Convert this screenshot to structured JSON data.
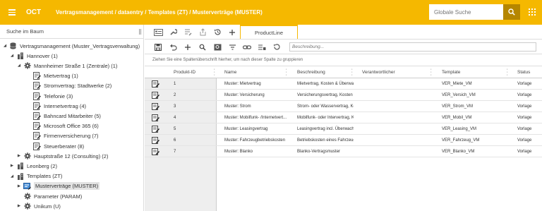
{
  "header": {
    "app_name": "OCT",
    "breadcrumb": "Vertragsmanagement / dataentry / Templates (ZT) / Musterverträge (MUSTER)",
    "search_placeholder": "Globale Suche"
  },
  "tree": {
    "search_label": "Suche im Baum",
    "nodes": [
      {
        "label": "Vertragsmanagement (Muster_Vertragsverwaltung)",
        "icon": "database-icon",
        "arrow": "open"
      },
      {
        "label": "Hannover (1)",
        "icon": "building-icon",
        "arrow": "open"
      },
      {
        "label": "Mannheimer Straße 1 (Zentrale) (1)",
        "icon": "gear-icon",
        "arrow": "open"
      },
      {
        "label": "Mietvertrag (1)",
        "icon": "contract-icon",
        "arrow": ""
      },
      {
        "label": "Stromvertrag: Stadtwerke (2)",
        "icon": "contract-icon",
        "arrow": ""
      },
      {
        "label": "Telefonie (3)",
        "icon": "contract-icon",
        "arrow": ""
      },
      {
        "label": "Internetvertrag (4)",
        "icon": "contract-icon",
        "arrow": ""
      },
      {
        "label": "Bahncard Mitarbeiter (5)",
        "icon": "contract-icon",
        "arrow": ""
      },
      {
        "label": "Microsoft Office 365 (6)",
        "icon": "contract-icon",
        "arrow": ""
      },
      {
        "label": "Firmenversicherung (7)",
        "icon": "contract-icon",
        "arrow": ""
      },
      {
        "label": "Steuerberater (8)",
        "icon": "contract-icon",
        "arrow": ""
      },
      {
        "label": "Hauptstraße 12 (Consulting) (2)",
        "icon": "gear-icon",
        "arrow": "closed"
      },
      {
        "label": "Leonberg (2)",
        "icon": "building-icon",
        "arrow": "closed"
      },
      {
        "label": "Templates (ZT)",
        "icon": "building-icon",
        "arrow": "open"
      },
      {
        "label": "Musterverträge (MUSTER)",
        "icon": "template-icon",
        "arrow": "closed",
        "selected": true
      },
      {
        "label": "Parameter (PARAM)",
        "icon": "gear-icon",
        "arrow": ""
      },
      {
        "label": "Unikum (U)",
        "icon": "gear-icon",
        "arrow": "closed"
      }
    ]
  },
  "tabs": {
    "active": "ProductLine"
  },
  "toolbar": {
    "description_placeholder": "Beschreibung..."
  },
  "group_hint": "Ziehen Sie eine Spaltenüberschrift hierher, um nach dieser Spalte zu gruppieren",
  "table": {
    "columns": [
      "Produkt-ID",
      "Name",
      "Beschreibung",
      "Verantwortlicher",
      "Template",
      "Status"
    ],
    "rows": [
      {
        "id": "1",
        "name": "Muster: Mietvertrag",
        "desc": "Mietvertrag, Kosten & Überwach...",
        "owner": "",
        "template": "VER_Miete_VM",
        "status": "Vorlage"
      },
      {
        "id": "2",
        "name": "Muster: Versicherung",
        "desc": "Versicherungsvertrag, Kosten & ...",
        "owner": "",
        "template": "VER_Versich_VM",
        "status": "Vorlage"
      },
      {
        "id": "3",
        "name": "Muster: Strom",
        "desc": "Strom- oder Wasservertrag, Ko...",
        "owner": "",
        "template": "VER_Strom_VM",
        "status": "Vorlage"
      },
      {
        "id": "4",
        "name": "Muster: Mobilfunk- /Internetvert...",
        "desc": "Mobilfunk- oder Intervertrag, K...",
        "owner": "",
        "template": "VER_Mobil_VM",
        "status": "Vorlage"
      },
      {
        "id": "5",
        "name": "Muster: Leasingvertrag",
        "desc": "Leasingvertrag incl. Überwachu...",
        "owner": "",
        "template": "VER_Leasing_VM",
        "status": "Vorlage"
      },
      {
        "id": "6",
        "name": "Muster: Fahrzeugbetriebskosten",
        "desc": "Betriebskosten eines Fahrzeugs...",
        "owner": "",
        "template": "VER_Fahrzeug_VM",
        "status": "Vorlage"
      },
      {
        "id": "7",
        "name": "Muster: Blanko",
        "desc": "Blanko-Vertragsmuster",
        "owner": "",
        "template": "VER_Blanko_VM",
        "status": "Vorlage"
      }
    ]
  },
  "colors": {
    "brand": "#f5b800",
    "search_button": "#b58600",
    "selection": "#e3e3e3"
  }
}
